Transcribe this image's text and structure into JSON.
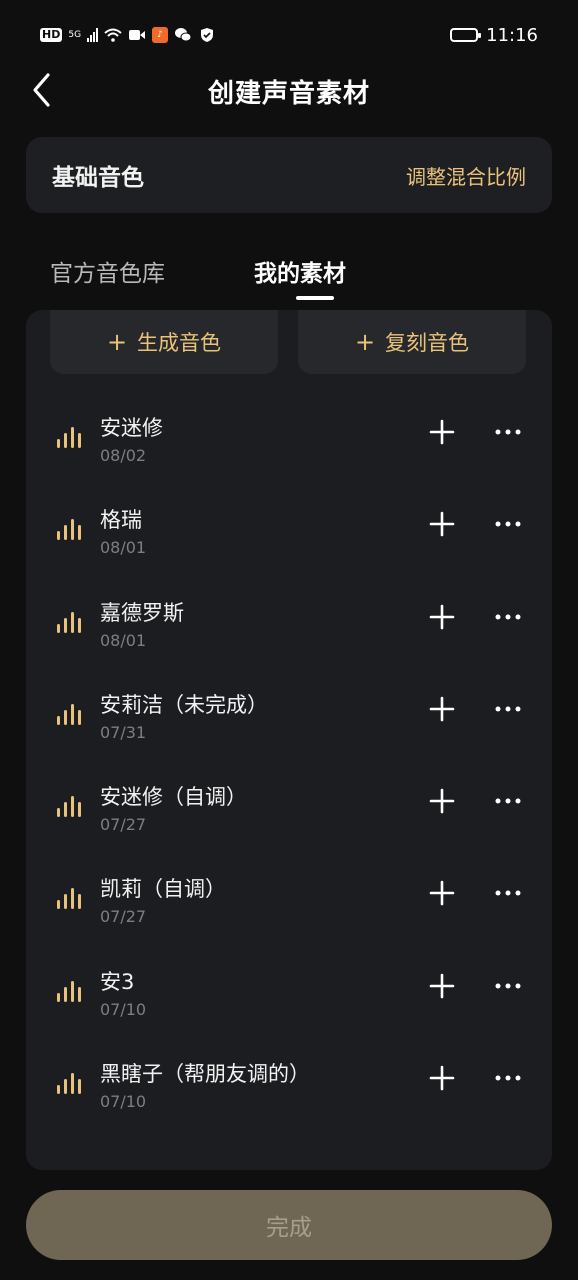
{
  "status_bar": {
    "hd": "HD",
    "network": "5G",
    "time": "11:16",
    "icons": [
      "hd-icon",
      "signal-icon",
      "wifi-icon",
      "video-icon",
      "app-notification-icon",
      "wechat-icon",
      "shield-icon",
      "battery-icon"
    ]
  },
  "header": {
    "back_icon": "chevron-left-icon",
    "title": "创建声音素材"
  },
  "base_card": {
    "title": "基础音色",
    "adjust_label": "调整混合比例"
  },
  "tabs": [
    {
      "label": "官方音色库",
      "active": false
    },
    {
      "label": "我的素材",
      "active": true
    }
  ],
  "actions": {
    "generate_label": "生成音色",
    "clone_label": "复刻音色",
    "plus": "+"
  },
  "voices": [
    {
      "name": "安迷修",
      "date": "08/02"
    },
    {
      "name": "格瑞",
      "date": "08/01"
    },
    {
      "name": "嘉德罗斯",
      "date": "08/01"
    },
    {
      "name": "安莉洁（未完成）",
      "date": "07/31"
    },
    {
      "name": "安迷修（自调）",
      "date": "07/27"
    },
    {
      "name": "凯莉（自调）",
      "date": "07/27"
    },
    {
      "name": "安3",
      "date": "07/10"
    },
    {
      "name": "黑瞎子（帮朋友调的）",
      "date": "07/10"
    }
  ],
  "done_label": "完成",
  "colors": {
    "background": "#0f0f10",
    "card": "#1e1f22",
    "accent_gold": "#e9c37a",
    "done_button": "#6f6653"
  }
}
